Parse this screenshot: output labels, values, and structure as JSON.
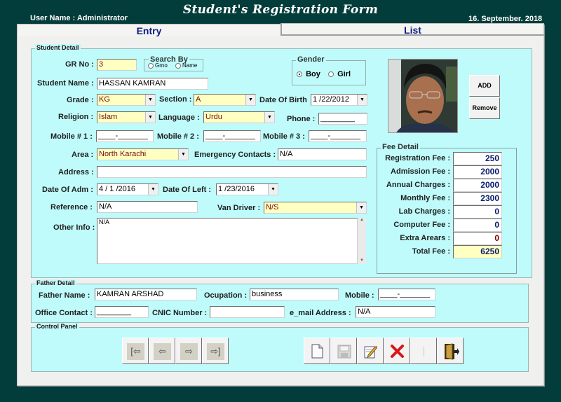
{
  "app": {
    "title": "Student's Registration Form",
    "user_label": "User Name :  Administrator",
    "date": "16. September. 2018"
  },
  "tabs": [
    {
      "label": "Entry",
      "active": true
    },
    {
      "label": "List",
      "active": false
    }
  ],
  "student_detail": {
    "group_title": "Student Detail",
    "gr_no": {
      "label": "GR No :",
      "value": "3"
    },
    "search_by": {
      "title": "Search By",
      "options": [
        "Grno",
        "Name"
      ]
    },
    "gender": {
      "title": "Gender",
      "options": [
        "Boy",
        "Girl"
      ],
      "selected": "Boy"
    },
    "student_name": {
      "label": "Student Name :",
      "value": "HASSAN KAMRAN"
    },
    "grade": {
      "label": "Grade :",
      "value": "KG"
    },
    "section": {
      "label": "Section :",
      "value": "A"
    },
    "dob": {
      "label": "Date Of Birth",
      "value": "1 /22/2012"
    },
    "religion": {
      "label": "Religion :",
      "value": "Islam"
    },
    "language": {
      "label": "Language :",
      "value": "Urdu"
    },
    "phone": {
      "label": "Phone :",
      "value": "________"
    },
    "mobile1": {
      "label": "Mobile # 1 :",
      "value": "____-_______"
    },
    "mobile2": {
      "label": "Mobile # 2 :",
      "value": "____-_______"
    },
    "mobile3": {
      "label": "Mobile # 3 :",
      "value": "____-_______"
    },
    "area": {
      "label": "Area :",
      "value": "North Karachi"
    },
    "emergency": {
      "label": "Emergency Contacts :",
      "value": "N/A"
    },
    "address": {
      "label": "Address :",
      "value": ""
    },
    "date_adm": {
      "label": "Date Of Adm :",
      "value": "4 / 1 /2016"
    },
    "date_left": {
      "label": "Date Of Left :",
      "value": "1 /23/2016"
    },
    "reference": {
      "label": "Reference :",
      "value": "N/A"
    },
    "van_driver": {
      "label": "Van Driver :",
      "value": "N/S"
    },
    "other_info": {
      "label": "Other Info :",
      "value": "N/A"
    }
  },
  "photo": {
    "add_label": "ADD",
    "remove_label": "Remove"
  },
  "fee_detail": {
    "group_title": "Fee Detail",
    "rows": [
      {
        "label": "Registration Fee :",
        "value": "250"
      },
      {
        "label": "Admission Fee :",
        "value": "2000"
      },
      {
        "label": "Annual Charges :",
        "value": "2000"
      },
      {
        "label": "Monthly Fee :",
        "value": "2300"
      },
      {
        "label": "Lab Charges :",
        "value": "0"
      },
      {
        "label": "Computer Fee :",
        "value": "0"
      },
      {
        "label": "Extra Arears :",
        "value": "0"
      },
      {
        "label": "Total Fee :",
        "value": "6250"
      }
    ],
    "colors": {
      "value": "#0b1c70",
      "arrears": "#8b0000",
      "total_bg": "#ffffc2"
    }
  },
  "father_detail": {
    "group_title": "Father Detail",
    "name": {
      "label": "Father Name :",
      "value": "KAMRAN ARSHAD"
    },
    "occupation": {
      "label": "Ocupation :",
      "value": "business"
    },
    "mobile": {
      "label": "Mobile :",
      "value": "____-_______"
    },
    "office_contact": {
      "label": "Office Contact :",
      "value": "________"
    },
    "cnic": {
      "label": "CNIC Number :",
      "value": ""
    },
    "email": {
      "label": "e_mail Address :",
      "value": "N/A"
    }
  },
  "control_panel": {
    "group_title": "Control Panel",
    "nav_buttons": [
      {
        "name": "first-record",
        "glyph": "[⇦"
      },
      {
        "name": "previous-record",
        "glyph": "⇦"
      },
      {
        "name": "next-record",
        "glyph": "⇨"
      },
      {
        "name": "last-record",
        "glyph": "⇨]"
      }
    ],
    "action_buttons": [
      {
        "name": "new-record",
        "icon": "new-document-icon"
      },
      {
        "name": "save-record",
        "icon": "save-disk-icon"
      },
      {
        "name": "edit-record",
        "icon": "edit-pencil-icon"
      },
      {
        "name": "delete-record",
        "icon": "delete-x-icon"
      },
      {
        "name": "blank-action",
        "icon": "blank-icon"
      },
      {
        "name": "exit",
        "icon": "exit-door-icon"
      }
    ]
  },
  "colors": {
    "background": "#033d3b",
    "panel": "#bffbfb",
    "tab_text": "#0c2080",
    "field_yellow": "#ffffc2"
  }
}
